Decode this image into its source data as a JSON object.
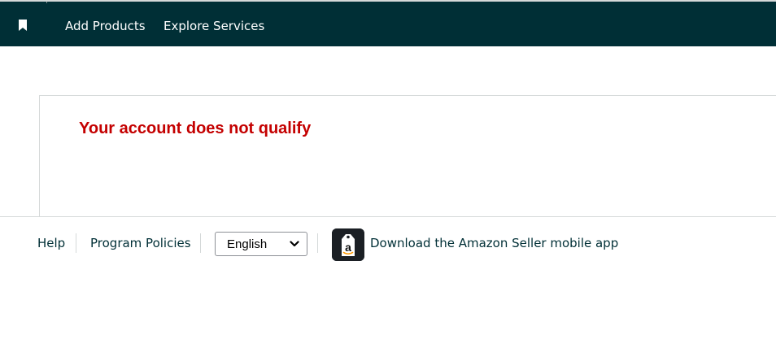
{
  "nav": {
    "bookmark_icon": "bookmark-icon",
    "add_products": "Add Products",
    "explore_services": "Explore Services"
  },
  "message": {
    "title": "Your account does not qualify"
  },
  "footer": {
    "help": "Help",
    "program_policies": "Program Policies",
    "language": {
      "selected": "English"
    },
    "app_icon": "amazon-seller-app-icon",
    "app_link": "Download the Amazon Seller mobile app"
  },
  "colors": {
    "nav_bg": "#002f36",
    "error_text": "#c40000",
    "link_text": "#002f36",
    "border": "#d5d9d9"
  }
}
